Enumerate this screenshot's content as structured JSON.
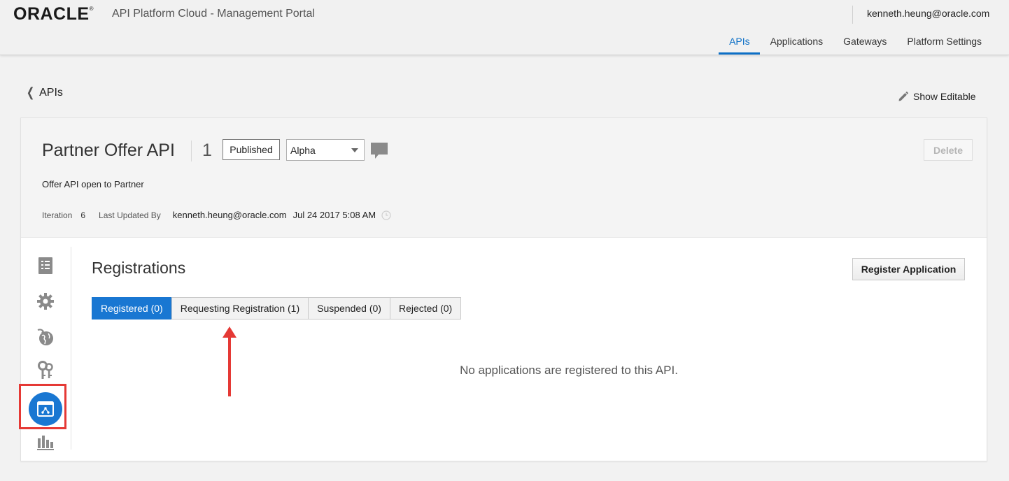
{
  "header": {
    "logo_text": "ORACLE",
    "logo_mark": "®",
    "portal_title": "API Platform Cloud - Management Portal",
    "user_email": "kenneth.heung@oracle.com",
    "nav": [
      {
        "label": "APIs",
        "active": true
      },
      {
        "label": "Applications",
        "active": false
      },
      {
        "label": "Gateways",
        "active": false
      },
      {
        "label": "Platform Settings",
        "active": false
      }
    ]
  },
  "breadcrumb": {
    "back_label": "APIs",
    "icon": "chevron-left-icon"
  },
  "actions": {
    "show_editable_label": "Show Editable",
    "icon": "pencil-icon"
  },
  "api": {
    "name": "Partner Offer API",
    "version": "1",
    "status_label": "Published",
    "release_value": "Alpha",
    "description": "Offer API open to Partner",
    "delete_label": "Delete",
    "iteration_label": "Iteration",
    "iteration_value": "6",
    "last_updated_label": "Last Updated By",
    "last_updated_by": "kenneth.heung@oracle.com",
    "last_updated_at": "Jul 24 2017 5:08 AM"
  },
  "side_nav": [
    {
      "icon": "api-definition-icon",
      "active": false
    },
    {
      "icon": "gear-icon",
      "active": false
    },
    {
      "icon": "globe-deploy-icon",
      "active": false
    },
    {
      "icon": "keys-icon",
      "active": false
    },
    {
      "icon": "registrations-icon",
      "active": true
    },
    {
      "icon": "analytics-bar-chart-icon",
      "active": false
    }
  ],
  "registrations": {
    "title": "Registrations",
    "register_button": "Register Application",
    "tabs": [
      {
        "label": "Registered (0)",
        "active": true
      },
      {
        "label": "Requesting Registration (1)",
        "active": false
      },
      {
        "label": "Suspended (0)",
        "active": false
      },
      {
        "label": "Rejected (0)",
        "active": false
      }
    ],
    "empty_message": "No applications are registered to this API."
  },
  "colors": {
    "accent": "#1977d2",
    "annotation": "#e53935"
  }
}
